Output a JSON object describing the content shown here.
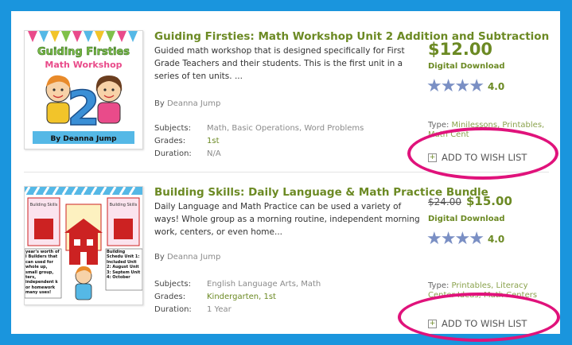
{
  "products": [
    {
      "title": "Guiding Firsties: Math Workshop Unit 2 Addition and Subtraction",
      "description": "Guided math workshop that is designed specifically for First Grade Teachers and their students. This is the first unit in a series of ten units. ...",
      "author_prefix": "By",
      "author": "Deanna Jump",
      "meta": [
        {
          "label": "Subjects:",
          "value": "Math, Basic Operations, Word Problems"
        },
        {
          "label": "Grades:",
          "value": "1st"
        },
        {
          "label": "Duration:",
          "value": "N/A"
        }
      ],
      "price": "$12.00",
      "delivery": "Digital Download",
      "rating": "4.0",
      "type_label": "Type:",
      "type_value": "Minilessons, Printables, Math Cent",
      "wish_label": "ADD TO WISH LIST",
      "cover": {
        "line1": "Guiding Firsties",
        "line2": "Math Workshop",
        "number": "2",
        "footer": "By Deanna Jump"
      }
    },
    {
      "title": "Building Skills: Daily Language & Math Practice Bundle",
      "description": "Daily Language and Math Practice can be used a variety of ways! Whole group as a morning routine, independent morning work, centers, or even home...",
      "author_prefix": "By",
      "author": "Deanna Jump",
      "meta": [
        {
          "label": "Subjects:",
          "value": "English Language Arts, Math"
        },
        {
          "label": "Grades:",
          "value": "Kindergarten, 1st"
        },
        {
          "label": "Duration:",
          "value": "1 Year"
        }
      ],
      "old_price": "$24.00",
      "price": "$15.00",
      "delivery": "Digital Download",
      "rating": "4.0",
      "type_label": "Type:",
      "type_value": "Printables, Literacy Center Ideas, Math Centers",
      "wish_label": "ADD TO WISH LIST",
      "cover": {
        "label": "Building Skills",
        "left_text": "year's worth of l Builders that can used for whole up, small group, ters, independent k or homework many uses!",
        "right_text": "Building Schedu Unit 1: Included Unit 2: August Unit 3: Septem Unit 4: October"
      }
    }
  ],
  "colors": {
    "background": "#1a95dd",
    "title_green": "#6c8a24",
    "highlight": "#e0127b",
    "star": "#7a8fc4"
  },
  "icons": {
    "star": "star-icon",
    "wish": "plus-box-icon"
  }
}
